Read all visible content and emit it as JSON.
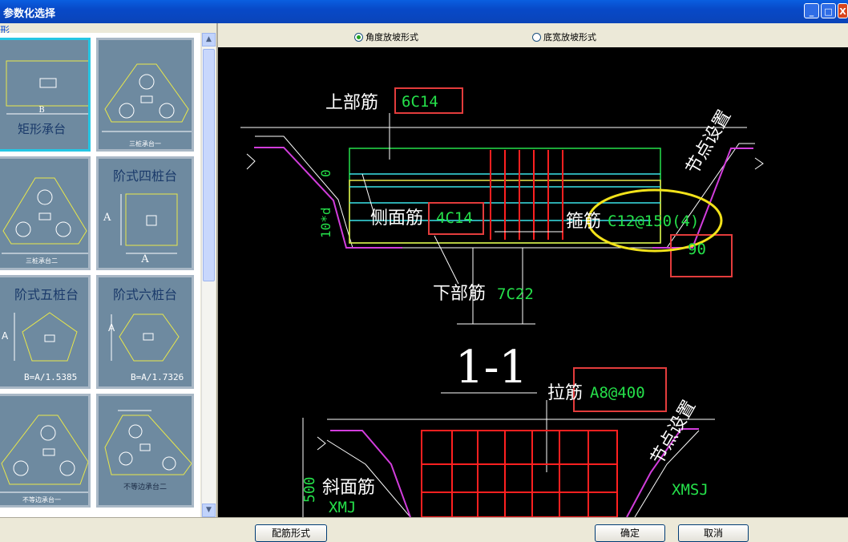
{
  "window": {
    "title": "参数化选择",
    "minimize": "_",
    "maximize": "□",
    "close": "X"
  },
  "left_panel": {
    "group_label": "形",
    "items": [
      {
        "label": "矩形承台",
        "dim": "B"
      },
      {
        "label": "三桩承台一"
      },
      {
        "label": "三桩承台二"
      },
      {
        "label": "阶式四桩台",
        "dim": "A"
      },
      {
        "label": "阶式五桩台",
        "dim": "A",
        "formula": "B=A/1.5385"
      },
      {
        "label": "阶式六桩台",
        "dim": "A",
        "formula": "B=A/1.7326"
      },
      {
        "label": "不等边承台一"
      },
      {
        "label": "不等边承台二"
      }
    ]
  },
  "options": {
    "radio1": "角度放坡形式",
    "radio2": "底宽放坡形式",
    "selected": "radio1"
  },
  "drawing": {
    "top_bar_label": "上部筋",
    "top_bar_value": "6C14",
    "side_bar_label": "侧面筋",
    "side_bar_value": "4C14",
    "stirrup_label": "箍筋",
    "stirrup_value": "C12@150(4)",
    "bottom_bar_label": "下部筋",
    "bottom_bar_value": "7C22",
    "angle_value": "90",
    "node_label": "节点设置",
    "dim_zero": "0",
    "dim_anchor": "10*d",
    "section_label": "1-1",
    "tie_label": "拉筋",
    "tie_value": "A8@400",
    "slope_label": "斜面筋",
    "slope_value": "XMJ",
    "right_slope_value": "XMSJ",
    "dim_500": "500",
    "node_label2": "节点设置"
  },
  "buttons": {
    "rebar_form": "配筋形式",
    "ok": "确定",
    "cancel": "取消"
  },
  "colors": {
    "cad_bg": "#000000",
    "cad_green": "#25e04a",
    "highlight_red": "#e33c3c",
    "ellipse_yellow": "#f2e21a",
    "beam_yellow": "#e9e84a",
    "rebar_cyan": "#3ae3e8",
    "rebar_red": "#ff2020",
    "pad_magenta": "#d23ddc"
  }
}
